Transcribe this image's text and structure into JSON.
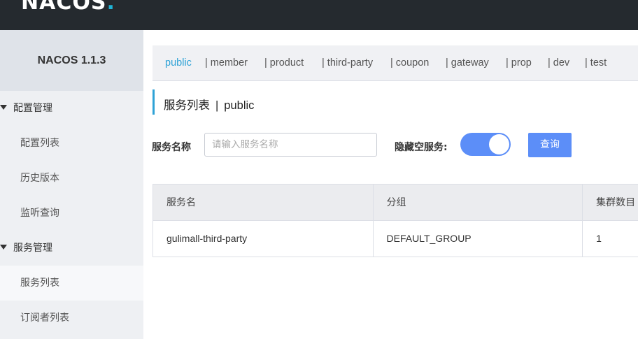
{
  "header": {
    "logo_main": "NACOS",
    "logo_dot": "."
  },
  "sidebar": {
    "version": "NACOS 1.1.3",
    "groups": [
      {
        "label": "配置管理",
        "items": [
          {
            "label": "配置列表"
          },
          {
            "label": "历史版本"
          },
          {
            "label": "监听查询"
          }
        ]
      },
      {
        "label": "服务管理",
        "items": [
          {
            "label": "服务列表",
            "active": true
          },
          {
            "label": "订阅者列表"
          }
        ]
      }
    ]
  },
  "namespaces": {
    "items": [
      "public",
      "| member",
      "| product",
      "| third-party",
      "| coupon",
      "| gateway",
      "| prop",
      "| dev",
      "| test"
    ],
    "active": "public"
  },
  "page": {
    "title": "服务列表",
    "separator": "|",
    "namespace": "public"
  },
  "search": {
    "label": "服务名称",
    "placeholder": "请输入服务名称",
    "value": "",
    "hide_empty_label": "隐藏空服务:",
    "hide_empty_on": true,
    "query_label": "查询"
  },
  "table": {
    "columns": [
      "服务名",
      "分组",
      "集群数目"
    ],
    "rows": [
      [
        "gulimall-third-party",
        "DEFAULT_GROUP",
        "1"
      ]
    ]
  },
  "colors": {
    "accent": "#2ea2d6",
    "primary_button": "#5c8ef8",
    "topbar": "#252a2f",
    "sidebar": "#eef0f3"
  }
}
